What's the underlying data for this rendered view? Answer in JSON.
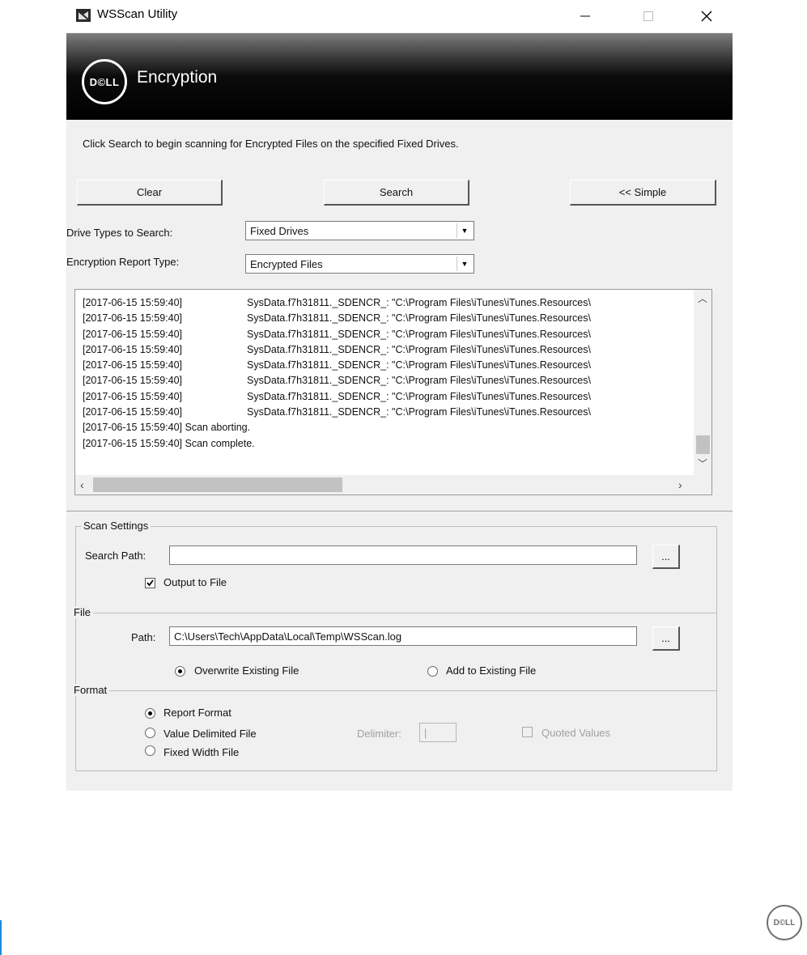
{
  "window": {
    "title": "WSScan Utility",
    "minimize": "—",
    "maximize": "☐",
    "close": "✕"
  },
  "banner": {
    "logo_text": "D©LL",
    "title": "Encryption"
  },
  "instructions": "Click Search to begin scanning for Encrypted Files on the specified Fixed Drives.",
  "buttons": {
    "clear": "Clear",
    "search": "Search",
    "simple": "<<  Simple"
  },
  "drive_types": {
    "label": "Drive Types to Search:",
    "value": "Fixed Drives"
  },
  "report_type": {
    "label": "Encryption Report Type:",
    "value": "Encrypted Files"
  },
  "log": [
    {
      "ts": "[2017-06-15 15:59:40]",
      "msg": "SysData.f7h31811._SDENCR_: \"C:\\Program Files\\iTunes\\iTunes.Resources\\"
    },
    {
      "ts": "[2017-06-15 15:59:40]",
      "msg": "SysData.f7h31811._SDENCR_: \"C:\\Program Files\\iTunes\\iTunes.Resources\\"
    },
    {
      "ts": "[2017-06-15 15:59:40]",
      "msg": "SysData.f7h31811._SDENCR_: \"C:\\Program Files\\iTunes\\iTunes.Resources\\"
    },
    {
      "ts": "[2017-06-15 15:59:40]",
      "msg": "SysData.f7h31811._SDENCR_: \"C:\\Program Files\\iTunes\\iTunes.Resources\\"
    },
    {
      "ts": "[2017-06-15 15:59:40]",
      "msg": "SysData.f7h31811._SDENCR_: \"C:\\Program Files\\iTunes\\iTunes.Resources\\"
    },
    {
      "ts": "[2017-06-15 15:59:40]",
      "msg": "SysData.f7h31811._SDENCR_: \"C:\\Program Files\\iTunes\\iTunes.Resources\\"
    },
    {
      "ts": "[2017-06-15 15:59:40]",
      "msg": "SysData.f7h31811._SDENCR_: \"C:\\Program Files\\iTunes\\iTunes.Resources\\"
    },
    {
      "ts": "[2017-06-15 15:59:40]",
      "msg": "SysData.f7h31811._SDENCR_: \"C:\\Program Files\\iTunes\\iTunes.Resources\\"
    },
    {
      "ts": "[2017-06-15 15:59:40] Scan aborting.",
      "msg": ""
    },
    {
      "ts": "[2017-06-15 15:59:40] Scan complete.",
      "msg": ""
    }
  ],
  "scan_settings": {
    "legend": "Scan Settings",
    "search_path_label": "Search Path:",
    "search_path_value": "",
    "browse": "...",
    "output_to_file_label": "Output to File",
    "output_to_file": true
  },
  "file": {
    "legend": "File",
    "path_label": "Path:",
    "path_value": "C:\\Users\\Tech\\AppData\\Local\\Temp\\WSScan.log",
    "browse": "...",
    "overwrite_label": "Overwrite Existing File",
    "add_label": "Add to Existing File",
    "selected": "overwrite"
  },
  "format": {
    "legend": "Format",
    "report_format": "Report Format",
    "value_delimited": "Value Delimited File",
    "fixed_width": "Fixed Width File",
    "selected": "report",
    "delimiter_label": "Delimiter:",
    "delimiter_value": "|",
    "quoted_values_label": "Quoted Values"
  },
  "footer_logo_text": "D©LL"
}
